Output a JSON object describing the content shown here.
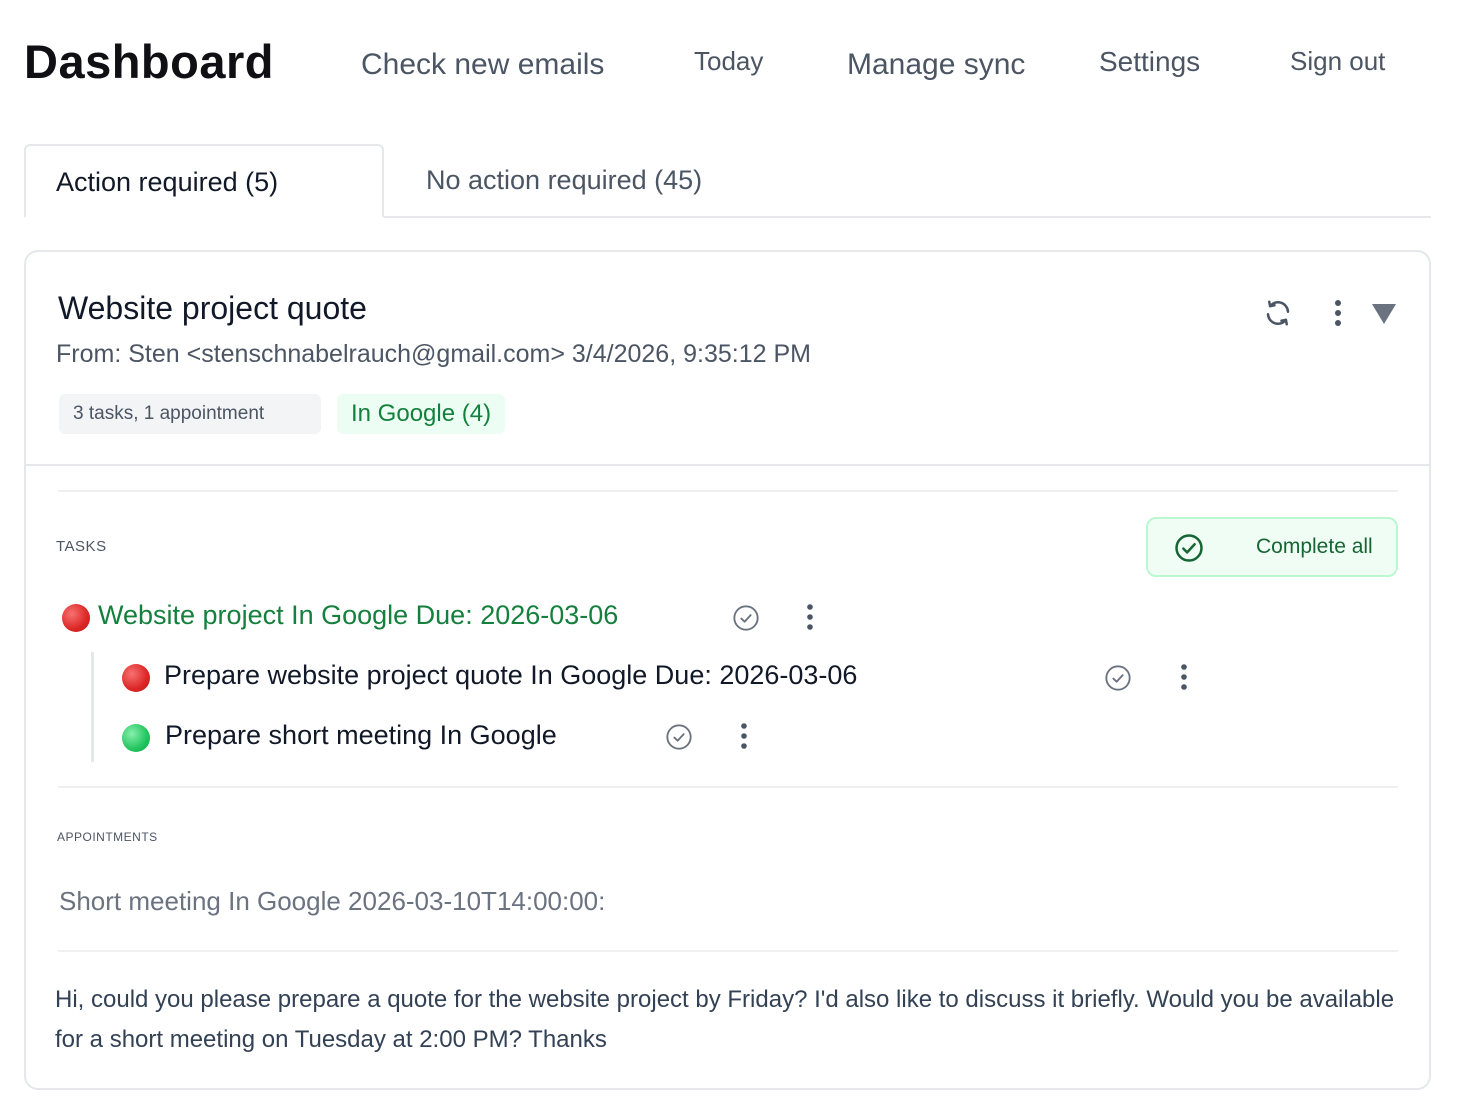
{
  "header": {
    "brand": "Dashboard",
    "nav": [
      "Check new emails",
      "Today",
      "Manage sync",
      "Settings",
      "Sign out"
    ]
  },
  "tabs": [
    {
      "label": "Action required (5)",
      "active": true
    },
    {
      "label": "No action required (45)",
      "active": false
    }
  ],
  "email": {
    "title": "Website project quote",
    "from": "From: Sten <stenschnabelrauch@gmail.com> 3/4/2026, 9:35:12 PM",
    "summary_badge": "3 tasks, 1 appointment",
    "sync_badge": "In Google (4)",
    "icons": {
      "refresh": "refresh-icon",
      "menu": "kebab-menu-icon",
      "collapse": "triangle-down-icon"
    },
    "tasks_label": "TASKS",
    "complete_all_label": "Complete all",
    "tasks": [
      {
        "text": "Website project In Google Due: 2026-03-06",
        "status_color": "#dc2626",
        "level": 0
      },
      {
        "text": "Prepare website project quote In Google Due: 2026-03-06",
        "status_color": "#dc2626",
        "level": 1
      },
      {
        "text": "Prepare short meeting In Google",
        "status_color": "#22c55e",
        "level": 1
      }
    ],
    "appointments_label": "APPOINTMENTS",
    "appointments": [
      "Short meeting In Google 2026-03-10T14:00:00:"
    ],
    "body": "Hi, could you please prepare a quote for the website project by Friday? I'd also like to discuss it briefly. Would you be available for a short meeting on Tuesday at 2:00 PM? Thanks"
  },
  "colors": {
    "accent_green": "#15803d",
    "badge_green_bg": "#ecfdf3",
    "border": "#e5e7eb",
    "status_red": "#dc2626",
    "status_green": "#22c55e"
  }
}
